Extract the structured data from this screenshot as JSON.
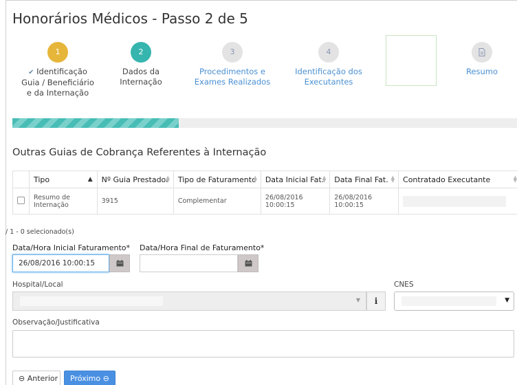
{
  "page": {
    "title": "Honorários Médicos - Passo 2 de 5"
  },
  "steps": [
    {
      "number": "1",
      "line1": "Identificação",
      "line2": "Guia / Beneficiário",
      "line3": "e da Internação"
    },
    {
      "number": "2",
      "line1": "Dados da",
      "line2": "Internação"
    },
    {
      "number": "3",
      "line1": "Procedimentos e",
      "line2": "Exames Realizados"
    },
    {
      "number": "4",
      "line1": "Identificação dos",
      "line2": "Executantes"
    },
    {
      "line1": "Resumo"
    }
  ],
  "progress": {
    "percent": 33
  },
  "colors": {
    "step_done": "#e6b63a",
    "step_active": "#36b5ae",
    "link": "#4a90d2",
    "primary": "#4a90e2"
  },
  "section": {
    "title": "Outras Guias de Cobrança Referentes à Internação"
  },
  "table": {
    "headers": [
      "Tipo",
      "Nº Guia Prestador",
      "Tipo de Faturamento",
      "Data Inicial Fat.",
      "Data Final Fat.",
      "Contratado Executante"
    ],
    "rows": [
      {
        "tipo_line1": "Resumo de",
        "tipo_line2": "Internação",
        "guia": "3915",
        "faturamento": "Complementar",
        "data_inicial": "26/08/2016 10:00:15",
        "data_final": "26/08/2016 10:00:15",
        "contratado": ""
      }
    ]
  },
  "selection_info": "/ 1 - 0 selecionado(s)",
  "form": {
    "data_inicial_label": "Data/Hora Inicial Faturamento*",
    "data_inicial_value": "26/08/2016 10:00:15",
    "data_final_label": "Data/Hora Final de Faturamento*",
    "data_final_value": "",
    "hospital_label": "Hospital/Local",
    "cnes_label": "CNES",
    "observacao_label": "Observação/Justificativa"
  },
  "buttons": {
    "anterior": "Anterior",
    "proximo": "Próximo"
  },
  "icons": {
    "calendar": "calendar-icon",
    "info": "info-icon",
    "check": "check-icon",
    "document": "document-icon",
    "arrow_left": "circle-arrow-left-icon",
    "arrow_right": "circle-arrow-right-icon"
  }
}
